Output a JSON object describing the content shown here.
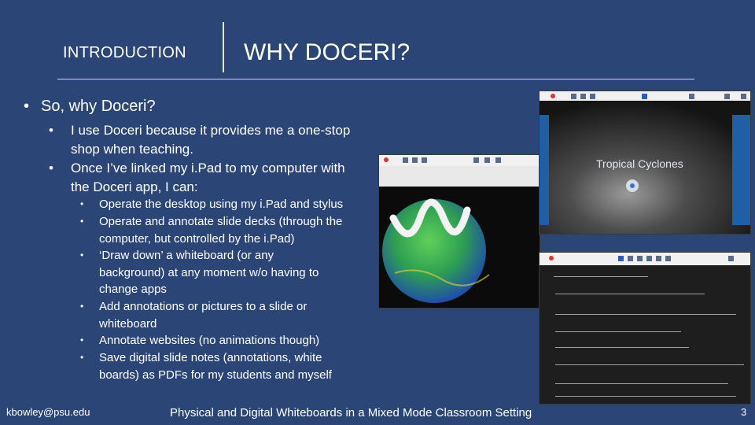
{
  "header": {
    "section": "INTRODUCTION",
    "title": "WHY DOCERI?"
  },
  "bullets": {
    "main": "So, why Doceri?",
    "sub1": [
      "I use Doceri because it provides me a one-stop",
      "shop when teaching."
    ],
    "sub2": [
      "Once I’ve linked my i.Pad to my computer with",
      "the Doceri app, I can:"
    ],
    "items": [
      [
        "Operate the desktop using my i.Pad and stylus"
      ],
      [
        "Operate and annotate slide decks (through the",
        "computer, but controlled by the i.Pad)"
      ],
      [
        "‘Draw down’ a whiteboard (or any",
        "background) at any moment w/o having to",
        "change apps"
      ],
      [
        "Add annotations or pictures to a slide or",
        "whiteboard"
      ],
      [
        "Annotate websites (no animations though)"
      ],
      [
        "Save digital slide notes (annotations, white",
        "boards) as PDFs for my students and myself"
      ]
    ]
  },
  "screenshots": {
    "cyclone_title": "Tropical Cyclones"
  },
  "footer": {
    "email": "kbowley@psu.edu",
    "title": "Physical and Digital Whiteboards in a Mixed Mode Classroom Setting",
    "page": "3"
  },
  "colors": {
    "background": "#2a4576",
    "text": "#ffffff",
    "chalkboard": "#1e1e1e",
    "globe_green": "#3fb24a",
    "globe_blue": "#2b6fd0"
  }
}
